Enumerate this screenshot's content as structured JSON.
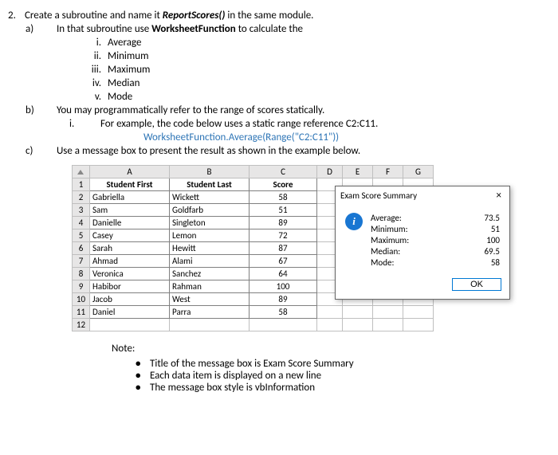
{
  "question": {
    "number": "2.",
    "text_pre": "Create a subroutine and name it ",
    "sub_name": "ReportScores()",
    "text_post": " in the same module.",
    "a": {
      "marker": "a)",
      "text_pre": "In that subroutine use ",
      "wf": "WorksheetFunction",
      "text_post": " to calculate the",
      "items": [
        {
          "marker": "i.",
          "label": "Average"
        },
        {
          "marker": "ii.",
          "label": "Minimum"
        },
        {
          "marker": "iii.",
          "label": "Maximum"
        },
        {
          "marker": "iv.",
          "label": "Median"
        },
        {
          "marker": "v.",
          "label": "Mode"
        }
      ]
    },
    "b": {
      "marker": "b)",
      "text": "You may programmatically refer to the range of scores statically.",
      "i": {
        "marker": "i.",
        "text": "For example, the code below uses a static range reference C2:C11."
      },
      "code": {
        "prefix": "WorksheetFunction.Average(Range(",
        "string": "\"C2:C11\"",
        "suffix": "))"
      }
    },
    "c": {
      "marker": "c)",
      "text": "Use a message box to present the result as shown in the example below."
    }
  },
  "sheet": {
    "cols": [
      "A",
      "B",
      "C",
      "D",
      "E",
      "F",
      "G"
    ],
    "header_first": "Student First",
    "header_last": "Student Last",
    "header_score": "Score",
    "rows": [
      {
        "n": "1"
      },
      {
        "n": "2",
        "first": "Gabriella",
        "last": "Wickett",
        "score": "58"
      },
      {
        "n": "3",
        "first": "Sam",
        "last": "Goldfarb",
        "score": "51"
      },
      {
        "n": "4",
        "first": "Danielle",
        "last": "Singleton",
        "score": "89"
      },
      {
        "n": "5",
        "first": "Casey",
        "last": "Lemon",
        "score": "72"
      },
      {
        "n": "6",
        "first": "Sarah",
        "last": "Hewitt",
        "score": "87"
      },
      {
        "n": "7",
        "first": "Ahmad",
        "last": "Alami",
        "score": "67"
      },
      {
        "n": "8",
        "first": "Veronica",
        "last": "Sanchez",
        "score": "64"
      },
      {
        "n": "9",
        "first": "Habibor",
        "last": "Rahman",
        "score": "100"
      },
      {
        "n": "10",
        "first": "Jacob",
        "last": "West",
        "score": "89"
      },
      {
        "n": "11",
        "first": "Daniel",
        "last": "Parra",
        "score": "58"
      },
      {
        "n": "12"
      }
    ]
  },
  "msgbox": {
    "title": "Exam Score Summary",
    "close": "×",
    "stats": [
      {
        "label": "Average:",
        "value": "73.5"
      },
      {
        "label": "Minimum:",
        "value": "51"
      },
      {
        "label": "Maximum:",
        "value": "100"
      },
      {
        "label": "Median:",
        "value": "69.5"
      },
      {
        "label": "Mode:",
        "value": "58"
      }
    ],
    "ok": "OK",
    "info_glyph": "i"
  },
  "notes": {
    "heading": "Note:",
    "items": [
      "Title of the message box is Exam Score Summary",
      "Each data item is displayed on a new line",
      "The message box style is vbInformation"
    ]
  }
}
